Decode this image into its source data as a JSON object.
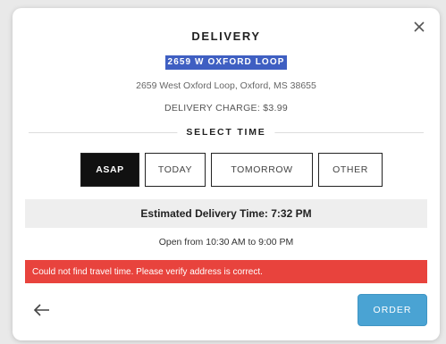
{
  "modal": {
    "title": "DELIVERY",
    "address_name": "2659 W OXFORD LOOP",
    "address_full": "2659 West Oxford Loop, Oxford, MS 38655",
    "delivery_charge": "DELIVERY CHARGE: $3.99"
  },
  "select_time": {
    "label": "SELECT TIME",
    "tabs": [
      {
        "label": "ASAP",
        "active": true
      },
      {
        "label": "TODAY",
        "active": false
      },
      {
        "label": "TOMORROW",
        "active": false
      },
      {
        "label": "OTHER",
        "active": false
      }
    ]
  },
  "estimate": {
    "text": "Estimated Delivery Time: 7:32 PM"
  },
  "hours": {
    "text": "Open from 10:30 AM to 9:00 PM"
  },
  "error": {
    "text": "Could not find travel time. Please verify address is correct."
  },
  "footer": {
    "order_label": "ORDER"
  },
  "icons": {
    "close": "close-icon",
    "back": "arrow-left-icon"
  },
  "colors": {
    "selected_address_highlight": "#3f5fc2",
    "active_tab": "#111111",
    "error_banner": "#e8433d",
    "order_button": "#4aa3d3"
  }
}
